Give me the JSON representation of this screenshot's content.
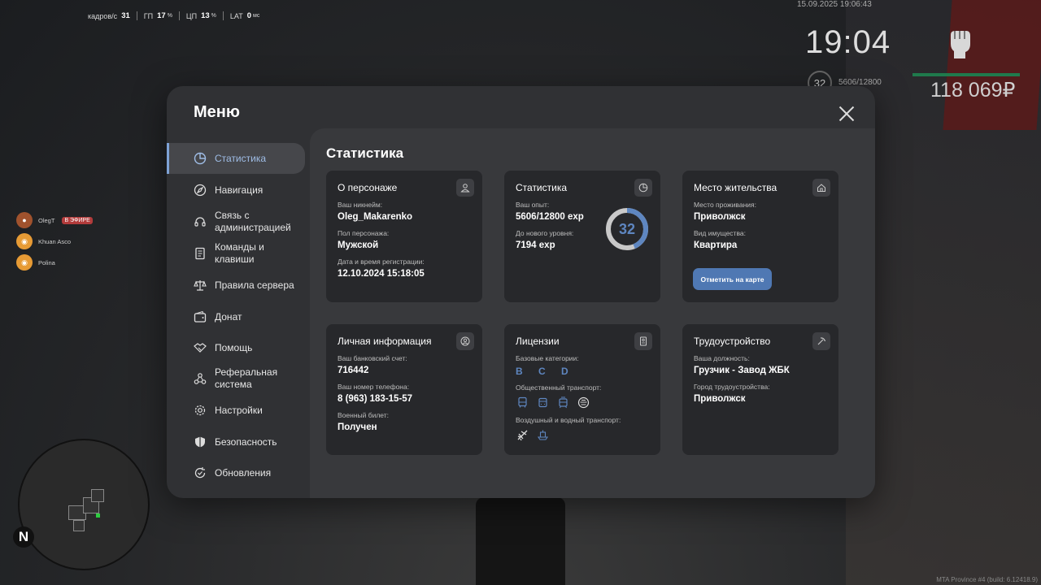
{
  "hud": {
    "fps_label": "кадров/с",
    "fps_value": "31",
    "gpu_label": "ГП",
    "gpu_value": "17",
    "cpu_label": "ЦП",
    "cpu_value": "13",
    "lat_label": "LAT",
    "lat_value": "0",
    "percent_unit": "%",
    "ms_unit": "мс",
    "datetime": "15.09.2025 19:06:43",
    "clock": "19:04",
    "level": "32",
    "exp": "5606/12800",
    "money": "118 069₽",
    "build": "MTA Province #4 (build: 6.12418.9)"
  },
  "voice": [
    {
      "name": "OlegT",
      "live": "В ЭФИРЕ"
    },
    {
      "name": "Khuan Asco"
    },
    {
      "name": "Polina"
    }
  ],
  "minimap": {
    "north": "N"
  },
  "menu": {
    "title": "Меню",
    "sidebar": [
      {
        "label": "Статистика",
        "icon": "pie-chart-icon"
      },
      {
        "label": "Навигация",
        "icon": "compass-icon"
      },
      {
        "label": "Связь с администрацией",
        "icon": "headset-icon"
      },
      {
        "label": "Команды и клавиши",
        "icon": "document-icon"
      },
      {
        "label": "Правила сервера",
        "icon": "scales-icon"
      },
      {
        "label": "Донат",
        "icon": "wallet-icon"
      },
      {
        "label": "Помощь",
        "icon": "handshake-icon"
      },
      {
        "label": "Реферальная система",
        "icon": "network-icon"
      },
      {
        "label": "Настройки",
        "icon": "gear-icon"
      },
      {
        "label": "Безопасность",
        "icon": "shield-icon"
      },
      {
        "label": "Обновления",
        "icon": "refresh-icon"
      }
    ],
    "content_title": "Статистика",
    "character": {
      "title": "О персонаже",
      "nick_label": "Ваш никнейм:",
      "nick": "Oleg_Makarenko",
      "gender_label": "Пол персонажа:",
      "gender": "Мужской",
      "reg_label": "Дата и время регистрации:",
      "reg": "12.10.2024 15:18:05"
    },
    "stats": {
      "title": "Статистика",
      "exp_label": "Ваш опыт:",
      "exp": "5606/12800 exp",
      "next_label": "До нового уровня:",
      "next": "7194 exp",
      "level": "32",
      "progress": 0.438
    },
    "residence": {
      "title": "Место жительства",
      "place_label": "Место проживания:",
      "place": "Приволжск",
      "type_label": "Вид имущества:",
      "type": "Квартира",
      "button": "Отметить на карте"
    },
    "personal": {
      "title": "Личная информация",
      "bank_label": "Ваш банковский счет:",
      "bank": "716442",
      "phone_label": "Ваш номер телефона:",
      "phone": "8 (963) 183-15-57",
      "military_label": "Военный билет:",
      "military": "Получен"
    },
    "licenses": {
      "title": "Лицензии",
      "basic_label": "Базовые категории:",
      "basic": "B C D",
      "public_label": "Общественный транспорт:",
      "air_label": "Воздушный и водный транспорт:"
    },
    "job": {
      "title": "Трудоустройство",
      "position_label": "Ваша должность:",
      "position": "Грузчик - Завод ЖБК",
      "city_label": "Город трудоустройства:",
      "city": "Приволжск"
    }
  }
}
